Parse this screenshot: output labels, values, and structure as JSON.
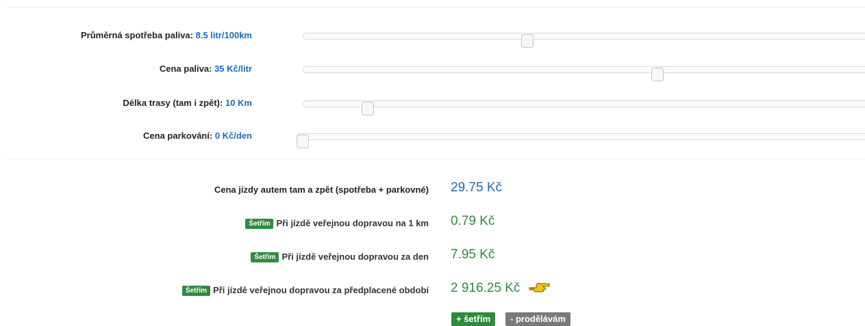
{
  "sliders": [
    {
      "label": "Průměrná spotřeba paliva:",
      "value": "8.5 litr/100km",
      "position": 0.4
    },
    {
      "label": "Cena paliva:",
      "value": "35 Kč/litr",
      "position": 0.63
    },
    {
      "label": "Délka trasy (tam i zpět):",
      "value": "10 Km",
      "position": 0.11
    },
    {
      "label": "Cena parkování:",
      "value": "0 Kč/den",
      "position": 0.0
    }
  ],
  "results": [
    {
      "badge": "",
      "label": "Cena jízdy autem tam a zpět (spotřeba + parkovné)",
      "value": "29.75 Kč",
      "color": "#1f6bb8"
    },
    {
      "badge": "Šetřím",
      "label": "Při jízdě veřejnou dopravou na 1 km",
      "value": "0.79 Kč",
      "color": "#2e8b3e"
    },
    {
      "badge": "Šetřím",
      "label": "Při jízdě veřejnou dopravou za den",
      "value": "7.95 Kč",
      "color": "#2e8b3e"
    },
    {
      "badge": "Šetřím",
      "label": "Při jízdě veřejnou dopravou za předplacené období",
      "value": "2 916.25 Kč",
      "color": "#2e8b3e",
      "icon": "pointing-hand-icon"
    }
  ],
  "buttons": {
    "save": "+ šetřím",
    "lose": "- prodělávám"
  },
  "colors": {
    "value_blue": "#1f6bb8",
    "save_green": "#2e8b3e",
    "lose_gray": "#7a7a7a"
  }
}
